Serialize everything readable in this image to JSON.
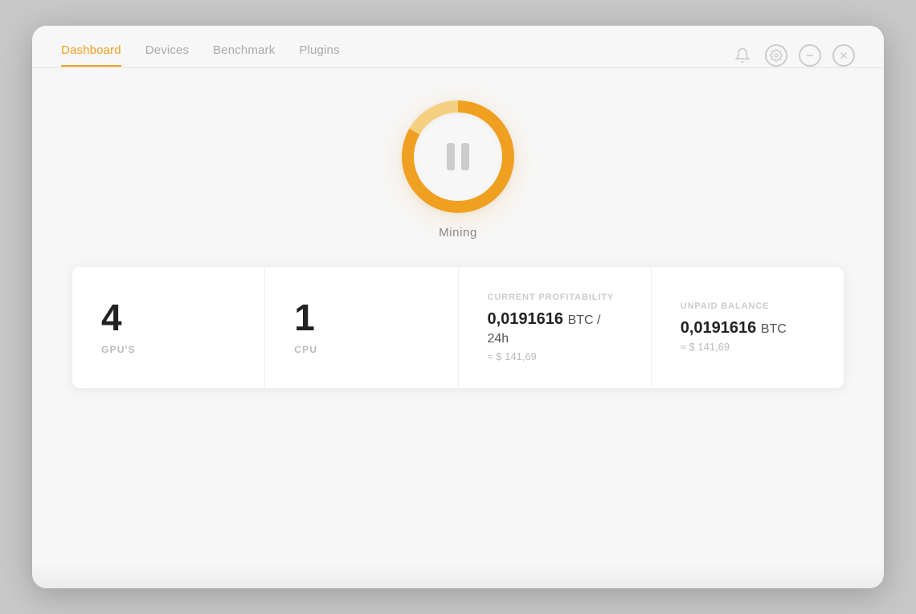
{
  "nav": {
    "items": [
      {
        "id": "dashboard",
        "label": "Dashboard",
        "active": true
      },
      {
        "id": "devices",
        "label": "Devices",
        "active": false
      },
      {
        "id": "benchmark",
        "label": "Benchmark",
        "active": false
      },
      {
        "id": "plugins",
        "label": "Plugins",
        "active": false
      }
    ]
  },
  "window_controls": {
    "bell_symbol": "🔔",
    "gear_symbol": "⚙",
    "minimize_symbol": "−",
    "close_symbol": "✕"
  },
  "mining": {
    "label": "Mining",
    "status": "paused"
  },
  "stats": {
    "gpus": {
      "value": "4",
      "label": "GPU'S"
    },
    "cpu": {
      "value": "1",
      "label": "CPU"
    },
    "profitability": {
      "section_label": "CURRENT PROFITABILITY",
      "btc_value": "0,0191616",
      "btc_unit": "BTC / 24h",
      "usd_approx": "≈ $ 141,69"
    },
    "balance": {
      "section_label": "UNPAID BALANCE",
      "btc_value": "0,0191616",
      "btc_unit": "BTC",
      "usd_approx": "≈ $ 141,69"
    }
  }
}
